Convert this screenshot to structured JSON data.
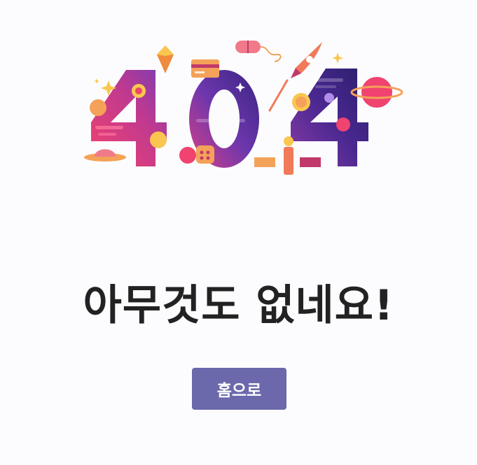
{
  "illustration": {
    "text": "404",
    "colors": {
      "pink": "#e8457a",
      "purple": "#7a3fb0",
      "navy": "#33207a",
      "orange": "#f4a259",
      "yellow": "#f9c74f"
    }
  },
  "heading": "아무것도 없네요!",
  "home_button": {
    "label": "홈으로",
    "color": "#6b68ab"
  }
}
